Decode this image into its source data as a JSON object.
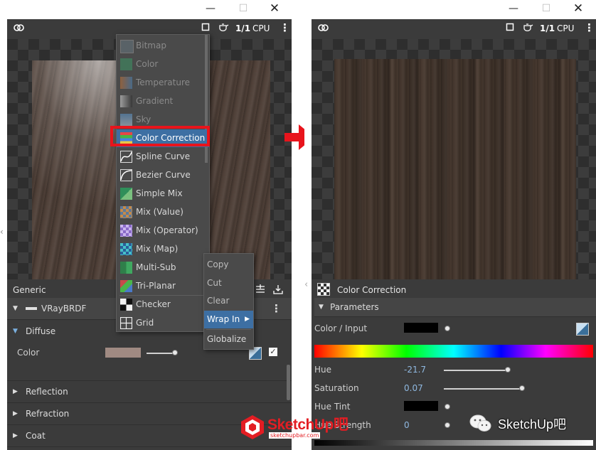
{
  "left_window": {
    "toolbar": {
      "ratio": "1/1",
      "engine": "CPU"
    },
    "section_generic": "Generic",
    "material_name": "VRayBRDF",
    "diffuse": {
      "title": "Diffuse",
      "color_label": "Color",
      "swatch": "#a08a82"
    },
    "sections": [
      "Reflection",
      "Refraction",
      "Coat"
    ],
    "context_menu": [
      {
        "label": "Bitmap",
        "icon": "bitmap-icon",
        "disabled": true
      },
      {
        "label": "Color",
        "icon": "color-icon",
        "disabled": true
      },
      {
        "label": "Temperature",
        "icon": "temperature-icon",
        "disabled": true
      },
      {
        "label": "Gradient",
        "icon": "gradient-icon",
        "disabled": true
      },
      {
        "label": "Sky",
        "icon": "sky-icon",
        "disabled": true
      },
      {
        "label": "Color Correction",
        "icon": "color-correction-icon",
        "disabled": false,
        "highlighted": true
      },
      {
        "label": "Spline Curve",
        "icon": "spline-curve-icon",
        "disabled": false
      },
      {
        "label": "Bezier Curve",
        "icon": "bezier-curve-icon",
        "disabled": false
      },
      {
        "label": "Simple Mix",
        "icon": "simple-mix-icon",
        "disabled": false
      },
      {
        "label": "Mix (Value)",
        "icon": "mix-value-icon",
        "disabled": false
      },
      {
        "label": "Mix (Operator)",
        "icon": "mix-operator-icon",
        "disabled": false
      },
      {
        "label": "Mix (Map)",
        "icon": "mix-map-icon",
        "disabled": false
      },
      {
        "label": "Multi-Sub",
        "icon": "multi-sub-icon",
        "disabled": false
      },
      {
        "label": "Tri-Planar",
        "icon": "tri-planar-icon",
        "disabled": false
      },
      {
        "label": "Checker",
        "icon": "checker-icon",
        "disabled": false
      },
      {
        "label": "Grid",
        "icon": "grid-icon",
        "disabled": false
      }
    ],
    "sub_menu": [
      "Copy",
      "Cut",
      "Clear",
      "Wrap In",
      "Globalize"
    ]
  },
  "right_window": {
    "toolbar": {
      "ratio": "1/1",
      "engine": "CPU"
    },
    "node_title": "Color Correction",
    "parameters_title": "Parameters",
    "color_input_label": "Color / Input",
    "params": [
      {
        "label": "Hue",
        "value": "-21.7"
      },
      {
        "label": "Saturation",
        "value": "0.07"
      },
      {
        "label": "Hue Tint",
        "value": ""
      },
      {
        "label": "Hue Strength",
        "value": "0"
      }
    ]
  },
  "watermark": {
    "brand": "SketchUp吧",
    "url": "sketchupbar.com",
    "wechat": "SketchUp吧"
  },
  "colors": {
    "highlight_box": "#e8141c",
    "arrow": "#e8141c",
    "panel_bg": "#3b3b3b"
  }
}
